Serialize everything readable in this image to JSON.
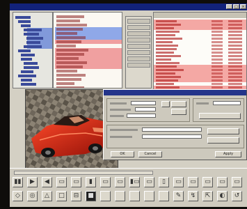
{
  "window": {
    "title": "",
    "controls": [
      "_",
      "□",
      "×"
    ]
  },
  "tree": {
    "row_count": 17
  },
  "list": {
    "row_count": 18
  },
  "table": {
    "row_count": 21
  },
  "dialog": {
    "ok_label": "OK",
    "cancel_label": "Cancel",
    "apply_label": "Apply"
  },
  "toolbar": {
    "row1": [
      "▮▮",
      "▶",
      "◀",
      "▭",
      "▭",
      "▮",
      "▭",
      "▭",
      "▮▭",
      "▭",
      "▯",
      "▭",
      "▭",
      "▭",
      "▭",
      "▭"
    ],
    "row2": [
      "◇",
      "◎",
      "△",
      "□",
      "⊟",
      "■",
      "",
      "",
      "",
      "",
      "",
      "✎",
      "↯",
      "⇱",
      "◐",
      "↺"
    ]
  },
  "colors": {
    "title_bar": "#12227a",
    "selection_pink": "#f4a8a4",
    "selection_blue": "#5f7fd8",
    "car_red": "#d41f12"
  }
}
